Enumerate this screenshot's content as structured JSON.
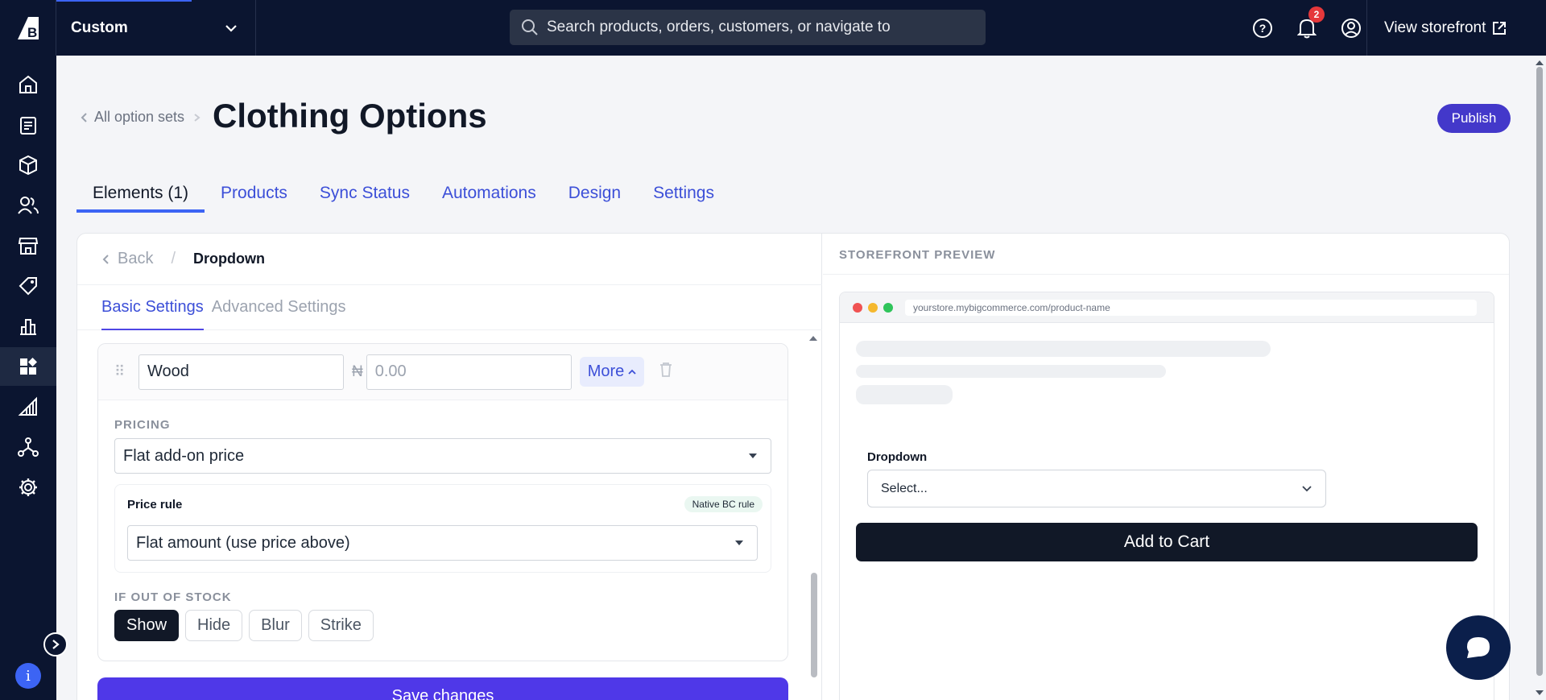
{
  "topbar": {
    "store_name": "Custom",
    "search_placeholder": "Search products, orders, customers, or navigate to",
    "notification_count": "2",
    "view_storefront": "View storefront"
  },
  "sidebar": {
    "items": [
      "home-icon",
      "orders-icon",
      "products-icon",
      "customers-icon",
      "storefront-icon",
      "marketing-icon",
      "analytics-icon",
      "apps-icon",
      "channels-icon",
      "integrations-icon",
      "settings-icon"
    ],
    "active_item": "apps-icon"
  },
  "header": {
    "breadcrumb": "All option sets",
    "title": "Clothing Options",
    "publish_label": "Publish"
  },
  "tabs": [
    {
      "label": "Elements (1)",
      "active": true
    },
    {
      "label": "Products",
      "active": false
    },
    {
      "label": "Sync Status",
      "active": false
    },
    {
      "label": "Automations",
      "active": false
    },
    {
      "label": "Design",
      "active": false
    },
    {
      "label": "Settings",
      "active": false
    }
  ],
  "editor": {
    "back_label": "Back",
    "current": "Dropdown",
    "subtabs": [
      "Basic Settings",
      "Advanced Settings"
    ],
    "option": {
      "value": "Wood",
      "currency_symbol": "₦",
      "price_placeholder": "0.00",
      "more_label": "More"
    },
    "pricing_label": "PRICING",
    "pricing_value": "Flat add-on price",
    "price_rule_label": "Price rule",
    "price_rule_badge": "Native BC rule",
    "price_rule_value": "Flat amount (use price above)",
    "stock_label": "IF OUT OF STOCK",
    "stock_options": [
      "Show",
      "Hide",
      "Blur",
      "Strike"
    ],
    "stock_selected": "Show",
    "save_label": "Save changes"
  },
  "preview": {
    "label": "STOREFRONT PREVIEW",
    "url": "yourstore.mybigcommerce.com/product-name",
    "dropdown_label": "Dropdown",
    "dropdown_placeholder": "Select...",
    "cart_label": "Add to Cart"
  },
  "colors": {
    "nav_bg": "#0b1530",
    "accent": "#4338ca",
    "link": "#3c4fd8",
    "badge": "#e5383b"
  }
}
